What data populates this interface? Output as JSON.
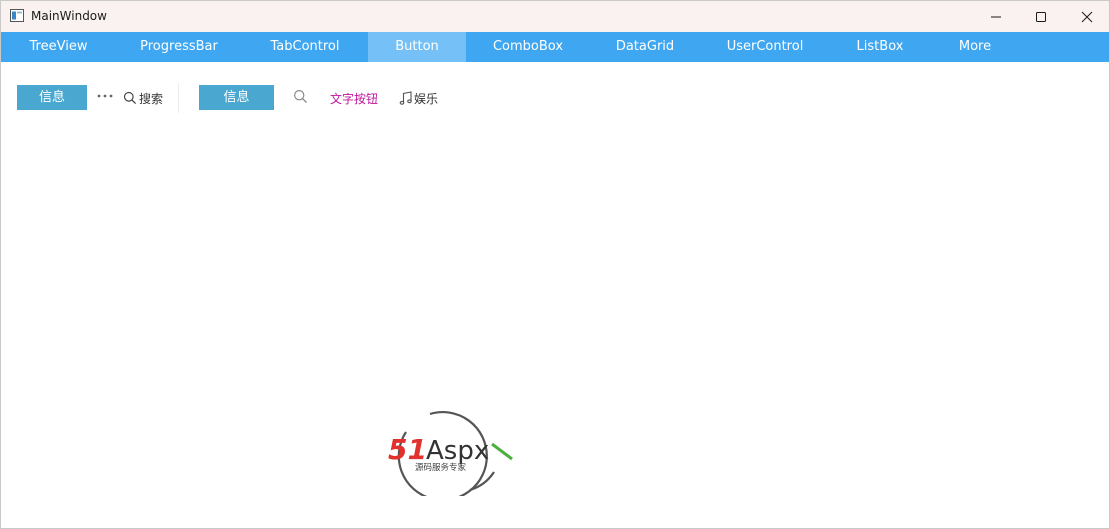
{
  "window": {
    "title": "MainWindow",
    "app_icon": "window-app-icon",
    "controls": [
      "minimize-icon",
      "maximize-icon",
      "close-icon"
    ]
  },
  "nav": {
    "accent_color": "#3fa7f2",
    "active_color": "#74c0f7",
    "active_index": 3,
    "items": [
      {
        "label": "TreeView"
      },
      {
        "label": "ProgressBar"
      },
      {
        "label": "TabControl"
      },
      {
        "label": "Button"
      },
      {
        "label": "ComboBox"
      },
      {
        "label": "DataGrid"
      },
      {
        "label": "UserControl"
      },
      {
        "label": "ListBox"
      },
      {
        "label": "More"
      }
    ]
  },
  "toolbar": {
    "info_button_label": "信息",
    "info_button_color": "#4aa7cf",
    "more_icon": "ellipsis-icon",
    "search_label": "搜索",
    "search_icon": "magnifier-icon",
    "info_button_2_label": "信息",
    "text_button_label": "文字按钮",
    "text_button_color": "#c0169b",
    "music_icon": "music-note-icon",
    "music_label": "娱乐"
  },
  "watermark": {
    "brand_number": "51",
    "brand_word": "Aspx",
    "tagline": "源码服务专家",
    "number_color": "#e0312e",
    "word_color": "#333333",
    "accent_color": "#4caf3f"
  }
}
